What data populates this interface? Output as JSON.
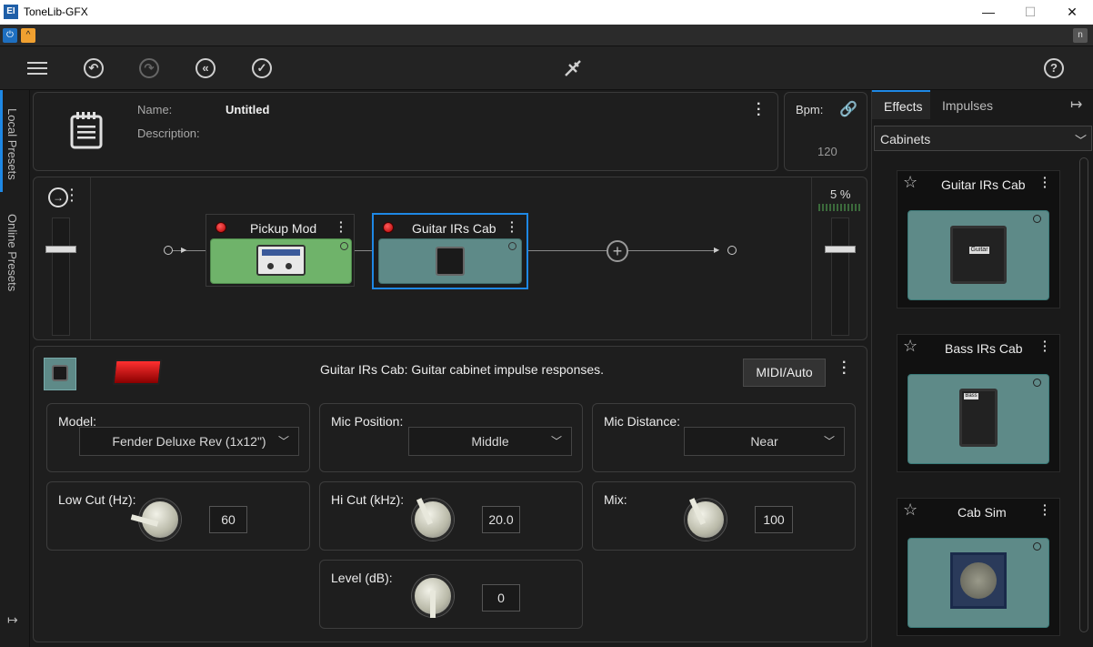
{
  "window": {
    "title": "ToneLib-GFX",
    "app_icon": "EI",
    "minimize": "—",
    "maximize": "☐",
    "close": "✕"
  },
  "bar2": {
    "power_icon": "power-icon",
    "expand_icon": "caret-up-icon",
    "n_label": "n"
  },
  "toolbar": {
    "icons": [
      "menu-icon",
      "undo-icon",
      "redo-icon",
      "revert-icon",
      "save-check-icon",
      "tuner-icon",
      "help-icon"
    ]
  },
  "left_tabs": {
    "local": "Local Presets",
    "online": "Online Presets"
  },
  "preset": {
    "name_label": "Name:",
    "name_value": "Untitled",
    "description_label": "Description:",
    "description_value": ""
  },
  "bpm": {
    "label": "Bpm:",
    "value": "120"
  },
  "chain": {
    "output_level": "5 %",
    "effects": [
      {
        "name": "Pickup Mod",
        "color": "#6fb36a"
      },
      {
        "name": "Guitar IRs Cab",
        "color": "#5e8a88"
      }
    ],
    "add_label": "+"
  },
  "editor": {
    "description": "Guitar IRs Cab:  Guitar cabinet impulse responses.",
    "midi_button": "MIDI/Auto",
    "params": {
      "model": {
        "label": "Model:",
        "value": "Fender Deluxe Rev (1x12\")"
      },
      "mic_position": {
        "label": "Mic Position:",
        "value": "Middle"
      },
      "mic_distance": {
        "label": "Mic Distance:",
        "value": "Near"
      },
      "low_cut": {
        "label": "Low Cut (Hz):",
        "value": "60"
      },
      "hi_cut": {
        "label": "Hi Cut (kHz):",
        "value": "20.0"
      },
      "mix": {
        "label": "Mix:",
        "value": "100"
      },
      "level": {
        "label": "Level (dB):",
        "value": "0"
      }
    }
  },
  "right_panel": {
    "tabs": [
      "Effects",
      "Impulses"
    ],
    "active_tab": "Effects",
    "category": "Cabinets",
    "cards": [
      {
        "name": "Guitar IRs Cab",
        "badge": "Guitar"
      },
      {
        "name": "Bass IRs Cab",
        "badge": "Bass"
      },
      {
        "name": "Cab Sim",
        "badge": ""
      }
    ]
  },
  "colors": {
    "accent_blue": "#1e88e5",
    "led_red": "#e02020",
    "cab_teal": "#5e8a88",
    "mod_green": "#6fb36a"
  }
}
